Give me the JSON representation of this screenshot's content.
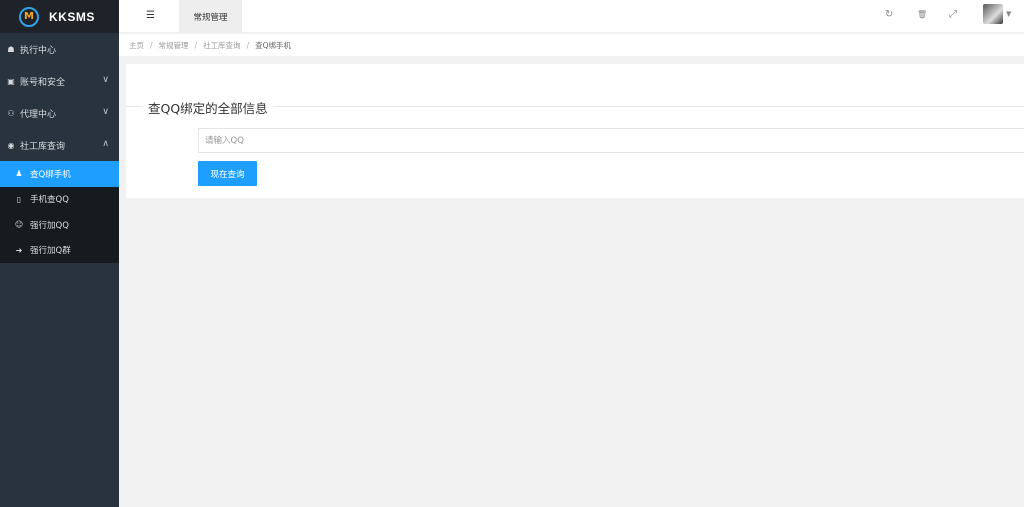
{
  "brand": {
    "name": "KKSMS",
    "logo_letter": "M"
  },
  "sidebar": {
    "items": [
      {
        "label": "执行中心",
        "icon": "home-icon",
        "glyph": "☗",
        "chevron": ""
      },
      {
        "label": "账号和安全",
        "icon": "id-card-icon",
        "glyph": "▣",
        "chevron": "∨"
      },
      {
        "label": "代理中心",
        "icon": "users-icon",
        "glyph": "⚇",
        "chevron": "∨"
      },
      {
        "label": "社工库查询",
        "icon": "eye-icon",
        "glyph": "◉",
        "chevron": "∧"
      }
    ],
    "subitems": [
      {
        "label": "查Q绑手机",
        "icon": "user-icon",
        "glyph": "♟"
      },
      {
        "label": "手机查QQ",
        "icon": "mobile-icon",
        "glyph": "▯"
      },
      {
        "label": "强行加QQ",
        "icon": "smile-icon",
        "glyph": "☺"
      },
      {
        "label": "强行加Q群",
        "icon": "sign-in-icon",
        "glyph": "➜"
      }
    ]
  },
  "header": {
    "menu_glyph": "☰",
    "tab_label": "常规管理",
    "refresh_glyph": "↻",
    "trash_glyph": "🗑",
    "fullscreen_glyph": "⤢",
    "caret_glyph": "▼"
  },
  "breadcrumb": {
    "items": [
      "主页",
      "常规管理",
      "社工库查询",
      "查Q绑手机"
    ],
    "separator": "/"
  },
  "main": {
    "title": "查QQ绑定的全部信息",
    "input_placeholder": "请输入QQ",
    "input_value": "",
    "button_label": "现在查询"
  },
  "colors": {
    "sidebar_bg": "#28333e",
    "logo_bg": "#20222a",
    "active": "#1e9fff",
    "page_bg": "#f2f2f2"
  }
}
